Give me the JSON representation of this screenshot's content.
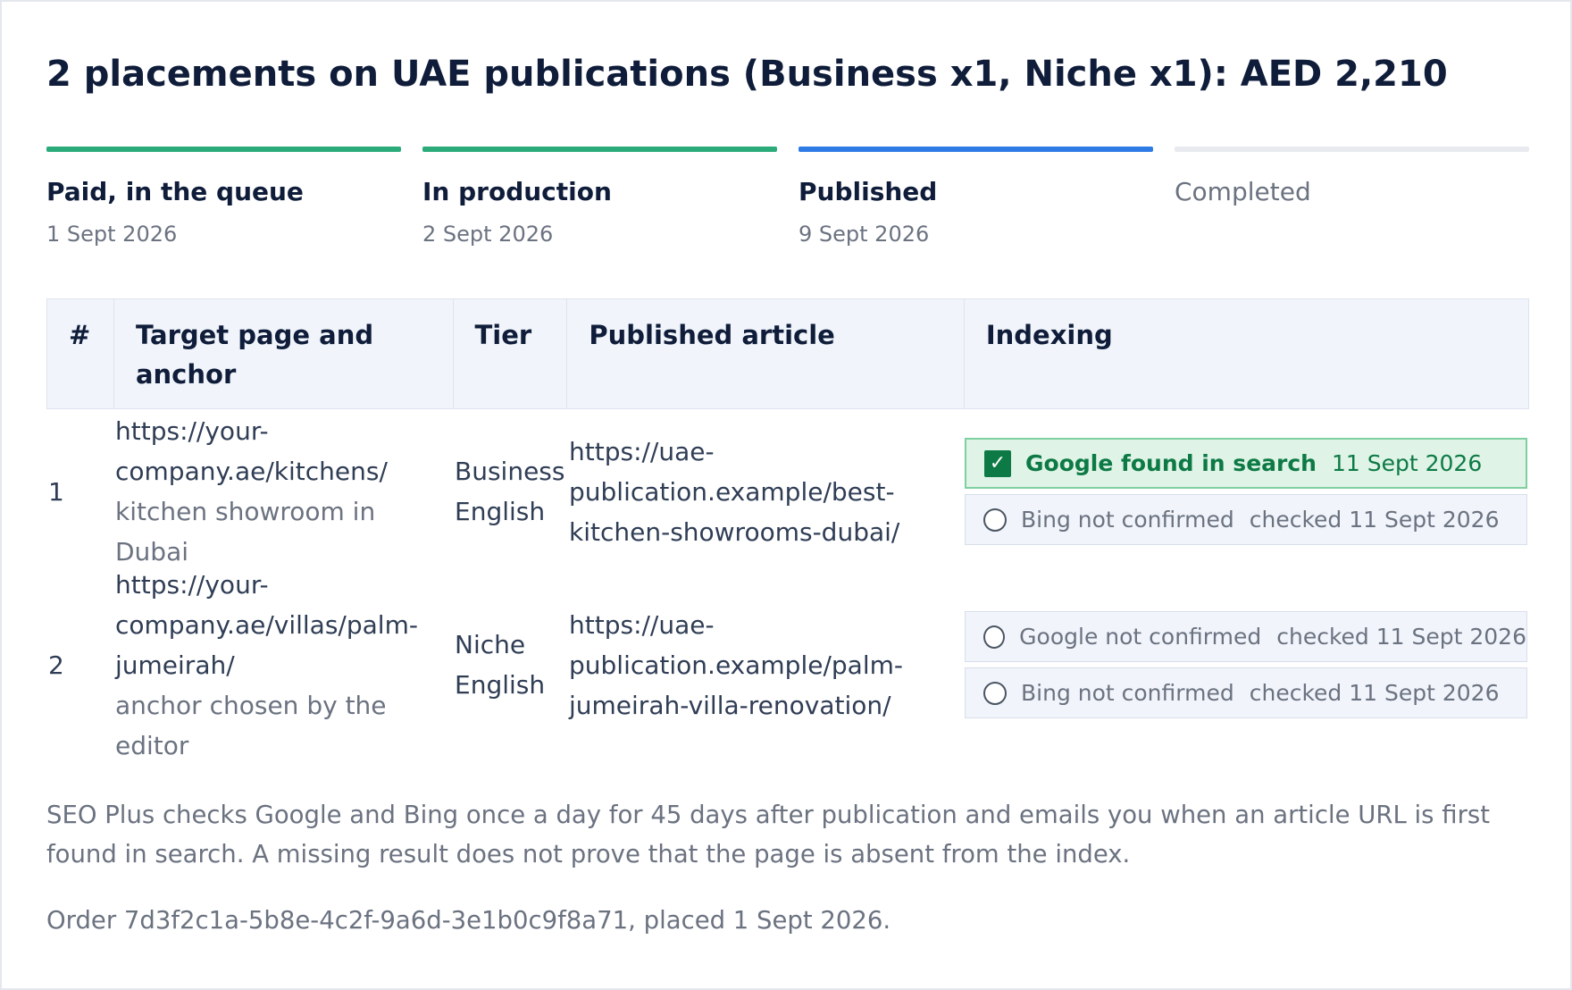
{
  "title": "2 placements on UAE publications (Business x1, Niche x1): AED 2,210",
  "steps": [
    {
      "label": "Paid, in the queue",
      "date": "1 Sept 2026",
      "state": "done",
      "color": "#2bab79"
    },
    {
      "label": "In production",
      "date": "2 Sept 2026",
      "state": "done",
      "color": "#2bab79"
    },
    {
      "label": "Published",
      "date": "9 Sept 2026",
      "state": "current",
      "color": "#2f7be6"
    },
    {
      "label": "Completed",
      "date": "",
      "state": "pending",
      "color": "#e8eaef"
    }
  ],
  "table": {
    "headers": [
      "#",
      "Target page and anchor",
      "Tier",
      "Published article",
      "Indexing"
    ],
    "rows": [
      {
        "num": "1",
        "target_url": "https://your-company.ae/kitchens/",
        "anchor": "kitchen showroom in Dubai",
        "tier": "Business English",
        "article_url": "https://uae-publication.example/best-kitchen-showrooms-dubai/",
        "indexing": [
          {
            "engine_status": "Google found in search",
            "date": "11 Sept 2026",
            "found": true,
            "icon": "check-icon"
          },
          {
            "engine_status": "Bing not confirmed",
            "date": "checked 11 Sept 2026",
            "found": false,
            "icon": "radio-icon"
          }
        ]
      },
      {
        "num": "2",
        "target_url": "https://your-company.ae/villas/palm-jumeirah/",
        "anchor": "anchor chosen by the editor",
        "tier": "Niche English",
        "article_url": "https://uae-publication.example/palm-jumeirah-villa-renovation/",
        "indexing": [
          {
            "engine_status": "Google not confirmed",
            "date": "checked 11 Sept 2026",
            "found": false,
            "icon": "radio-icon"
          },
          {
            "engine_status": "Bing not confirmed",
            "date": "checked 11 Sept 2026",
            "found": false,
            "icon": "radio-icon"
          }
        ]
      }
    ]
  },
  "note": "SEO Plus checks Google and Bing once a day for 45 days after publication and emails you when an article URL is first found in search. A missing result does not prove that the page is absent from the index.",
  "order": "Order 7d3f2c1a-5b8e-4c2f-9a6d-3e1b0c9f8a71, placed 1 Sept 2026.",
  "colors": {
    "accent_green": "#2bab79",
    "accent_blue": "#2f7be6",
    "found_green": "#0d7a45"
  }
}
